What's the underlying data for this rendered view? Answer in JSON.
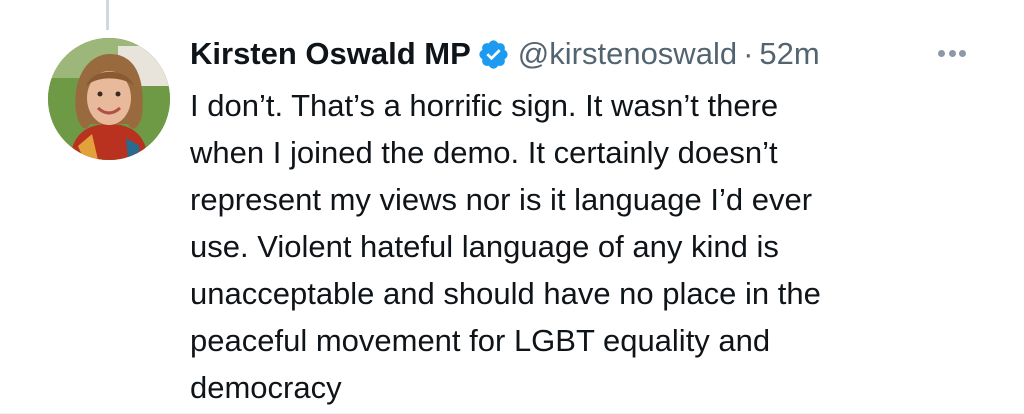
{
  "author": {
    "name": "Kirsten Oswald MP",
    "handle": "@kirstenoswald",
    "separator": "·",
    "time": "52m",
    "verified": true
  },
  "tweet": {
    "lines": [
      "I don’t. That’s a horrific sign. It wasn’t there",
      "when I joined the demo. It certainly doesn’t",
      "represent my views nor is it language I’d ever",
      "use. Violent hateful language of any kind is",
      "unacceptable and should have no place in the",
      "peaceful movement for LGBT equality and",
      "democracy"
    ]
  },
  "icons": {
    "verified": "verified-badge-icon",
    "more": "more-options-icon"
  },
  "colors": {
    "verified_blue": "#1d9bf0",
    "text": "#0f1419",
    "secondary_text": "#536471",
    "thread_line": "#cfd9de"
  }
}
